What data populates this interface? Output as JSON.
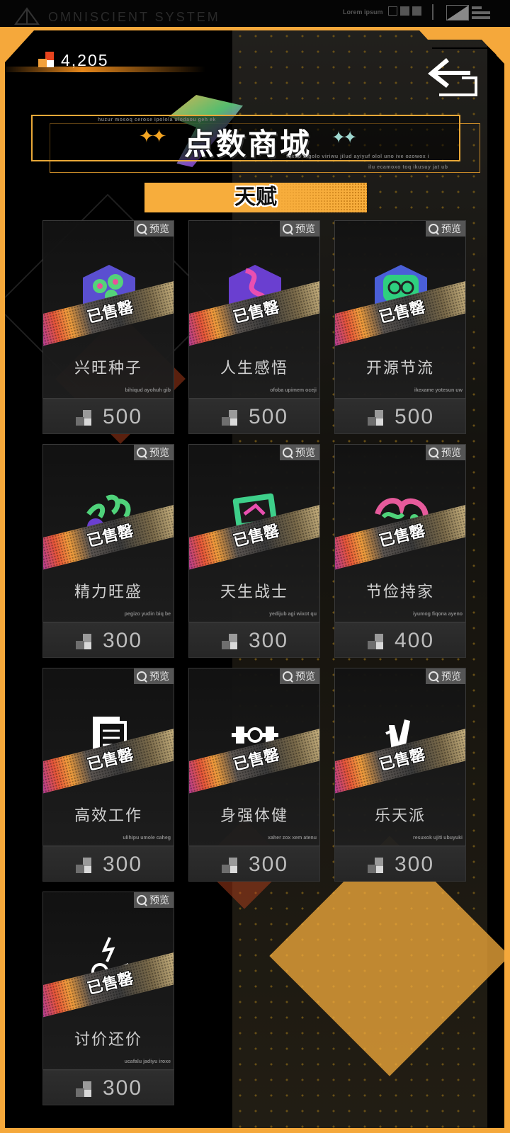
{
  "system_bar": {
    "title": "OMNISCIENT SYSTEM",
    "lorem": "Lorem ipsum"
  },
  "currency": {
    "icon": "points-cube-icon",
    "value": "4,205"
  },
  "back_button": {
    "icon": "back-arrow-icon"
  },
  "title": {
    "text": "点数商城",
    "tiny_top": "huzur mosoq cerose ipolola ulodaou geh ek",
    "tiny_mid": "foxuo bigolo viriwu jilud ayiyuf olol uno ive ozowox i",
    "tiny_bottom": "ilu ecamoxo toq ikusuy jat ub"
  },
  "category_tab": {
    "label": "天赋"
  },
  "preview_label": "预览",
  "sold_label": "已售罄",
  "colors": {
    "accent": "#f7ad3c",
    "card_bg": "#151515",
    "price_bar": "#2a2a2a"
  },
  "items": [
    {
      "name": "兴旺种子",
      "price": "500",
      "code": "bihiqud ayohuh gib",
      "icon": "sprout-badge-icon"
    },
    {
      "name": "人生感悟",
      "price": "500",
      "code": "ofoba upimem oceji",
      "icon": "road-badge-icon"
    },
    {
      "name": "开源节流",
      "price": "500",
      "code": "ikexame yotesun uw",
      "icon": "coins-badge-icon"
    },
    {
      "name": "精力旺盛",
      "price": "300",
      "code": "pegizo yudin biq be",
      "icon": "energy-badge-icon"
    },
    {
      "name": "天生战士",
      "price": "300",
      "code": "yedijub agi wixot qu",
      "icon": "warrior-badge-icon"
    },
    {
      "name": "节俭持家",
      "price": "400",
      "code": "iyumog fiqona ayeno",
      "icon": "thrift-badge-icon"
    },
    {
      "name": "高效工作",
      "price": "300",
      "code": "ulihipu umole caheg",
      "icon": "documents-badge-icon"
    },
    {
      "name": "身强体健",
      "price": "300",
      "code": "xaher zox xem atenu",
      "icon": "fitness-badge-icon"
    },
    {
      "name": "乐天派",
      "price": "300",
      "code": "resuxok ujiti ubuyuki",
      "icon": "peace-hand-badge-icon"
    },
    {
      "name": "讨价还价",
      "price": "300",
      "code": "ucafalu jadiyu iroxe",
      "icon": "bargain-badge-icon"
    }
  ]
}
